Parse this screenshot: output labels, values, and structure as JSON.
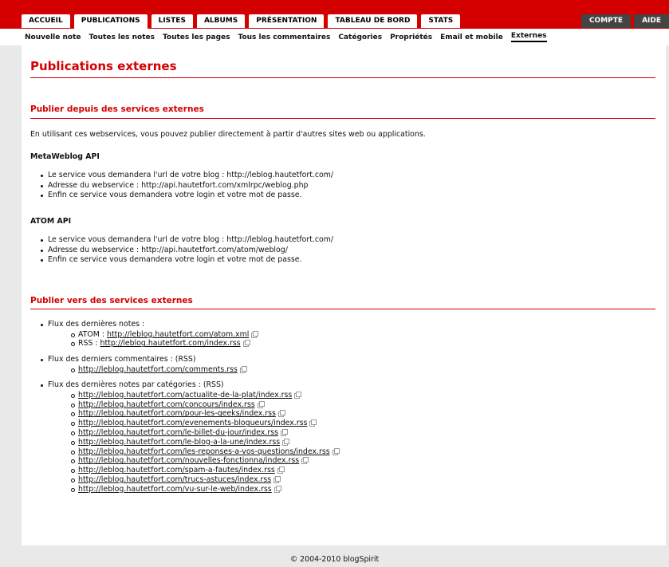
{
  "nav": {
    "tabs": [
      "ACCUEIL",
      "PUBLICATIONS",
      "LISTES",
      "ALBUMS",
      "PRÉSENTATION",
      "TABLEAU DE BORD",
      "STATS"
    ],
    "active_tab": "PUBLICATIONS",
    "right_tabs": [
      "COMPTE",
      "AIDE"
    ],
    "subtabs": [
      "Nouvelle note",
      "Toutes les notes",
      "Toutes les pages",
      "Tous les commentaires",
      "Catégories",
      "Propriétés",
      "Email et mobile",
      "Externes"
    ],
    "active_subtab": "Externes"
  },
  "page": {
    "title": "Publications externes",
    "section1": {
      "title": "Publier depuis des services externes",
      "intro": "En utilisant ces webservices, vous pouvez publier directement à partir d'autres sites web ou applications.",
      "meta": {
        "title": "MetaWeblog API",
        "items": [
          "Le service vous demandera l'url de votre blog : http://leblog.hautetfort.com/",
          "Adresse du webservice : http://api.hautetfort.com/xmlrpc/weblog.php",
          "Enfin ce service vous demandera votre login et votre mot de passe."
        ]
      },
      "atom": {
        "title": "ATOM API",
        "items": [
          "Le service vous demandera l'url de votre blog : http://leblog.hautetfort.com/",
          "Adresse du webservice : http://api.hautetfort.com/atom/weblog/",
          "Enfin ce service vous demandera votre login et votre mot de passe."
        ]
      }
    },
    "section2": {
      "title": "Publier vers des services externes",
      "groups": [
        {
          "label": "Flux des dernières notes :",
          "links": [
            {
              "prefix": "ATOM : ",
              "url": "http://leblog.hautetfort.com/atom.xml"
            },
            {
              "prefix": "RSS : ",
              "url": "http://leblog.hautetfort.com/index.rss"
            }
          ]
        },
        {
          "label": "Flux des derniers commentaires : (RSS)",
          "links": [
            {
              "prefix": "",
              "url": "http://leblog.hautetfort.com/comments.rss"
            }
          ]
        },
        {
          "label": "Flux des dernières notes par catégories : (RSS)",
          "links": [
            {
              "prefix": "",
              "url": "http://leblog.hautetfort.com/actualite-de-la-plat/index.rss"
            },
            {
              "prefix": "",
              "url": "http://leblog.hautetfort.com/concours/index.rss"
            },
            {
              "prefix": "",
              "url": "http://leblog.hautetfort.com/pour-les-geeks/index.rss"
            },
            {
              "prefix": "",
              "url": "http://leblog.hautetfort.com/evenements-blogueurs/index.rss"
            },
            {
              "prefix": "",
              "url": "http://leblog.hautetfort.com/le-billet-du-jour/index.rss"
            },
            {
              "prefix": "",
              "url": "http://leblog.hautetfort.com/le-blog-a-la-une/index.rss"
            },
            {
              "prefix": "",
              "url": "http://leblog.hautetfort.com/les-reponses-a-vos-questions/index.rss"
            },
            {
              "prefix": "",
              "url": "http://leblog.hautetfort.com/nouvelles-fonctionna/index.rss"
            },
            {
              "prefix": "",
              "url": "http://leblog.hautetfort.com/spam-a-fautes/index.rss"
            },
            {
              "prefix": "",
              "url": "http://leblog.hautetfort.com/trucs-astuces/index.rss"
            },
            {
              "prefix": "",
              "url": "http://leblog.hautetfort.com/vu-sur-le-web/index.rss"
            }
          ]
        }
      ]
    }
  },
  "footer": "© 2004-2010 blogSpirit",
  "colors": {
    "accent": "#d40000",
    "page_bg": "#e9e9e9",
    "dark_tab": "#444444"
  },
  "icons": {
    "external_link": "external-link-icon"
  }
}
